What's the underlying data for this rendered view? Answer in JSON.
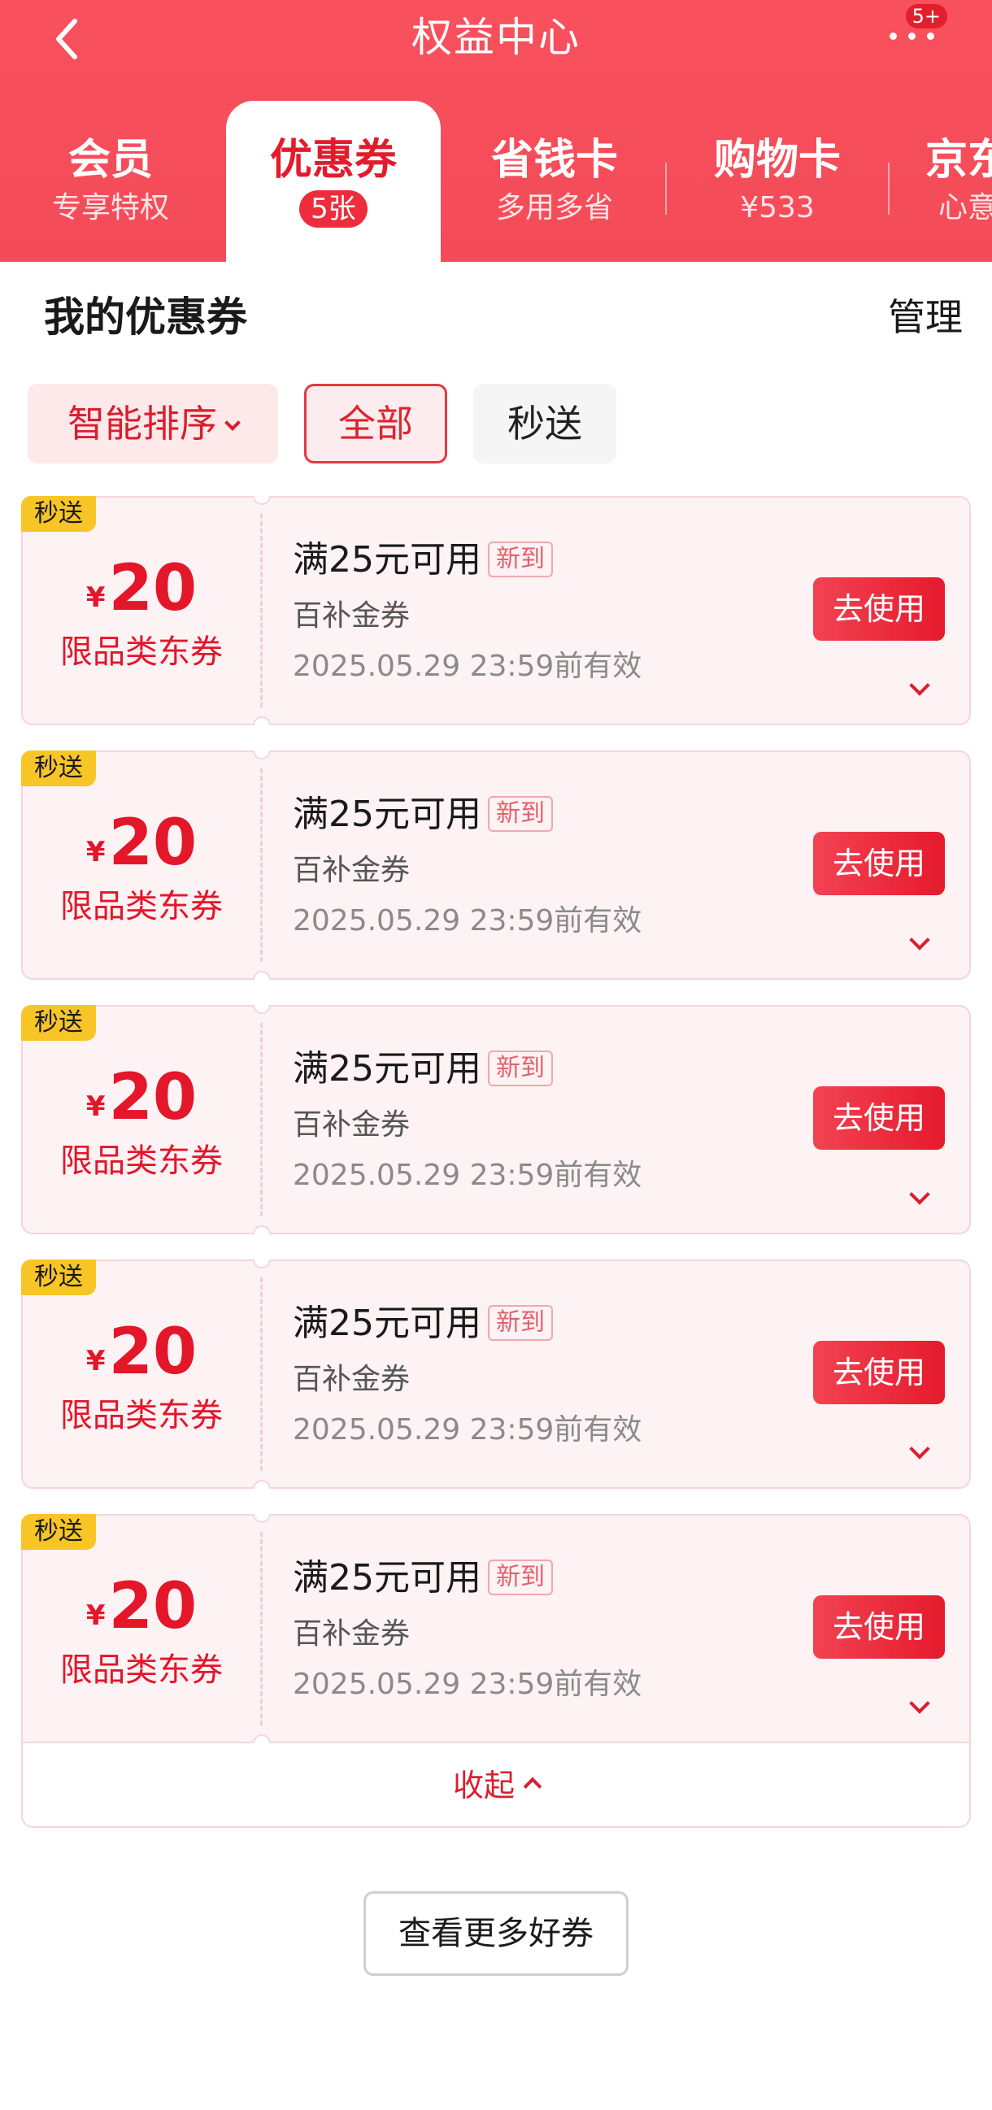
{
  "header": {
    "title": "权益中心",
    "more_badge": "5+",
    "tabs": [
      {
        "title": "会员",
        "subtitle": "专享特权"
      },
      {
        "title": "优惠券",
        "subtitle": "5张"
      },
      {
        "title": "省钱卡",
        "subtitle": "多用多省"
      },
      {
        "title": "购物卡",
        "subtitle": "¥533"
      },
      {
        "title": "京东",
        "subtitle": "心意"
      }
    ],
    "active_tab": "优惠券"
  },
  "section": {
    "title": "我的优惠券",
    "manage_label": "管理"
  },
  "filters": {
    "sort_label": "智能排序",
    "all_label": "全部",
    "fast_label": "秒送",
    "selected": "全部"
  },
  "coupons": [
    {
      "tag": "秒送",
      "currency": "¥",
      "amount": "20",
      "category": "限品类东券",
      "condition": "满25元可用",
      "new_badge": "新到",
      "type": "百补金券",
      "valid": "2025.05.29 23:59前有效",
      "button": "去使用"
    },
    {
      "tag": "秒送",
      "currency": "¥",
      "amount": "20",
      "category": "限品类东券",
      "condition": "满25元可用",
      "new_badge": "新到",
      "type": "百补金券",
      "valid": "2025.05.29 23:59前有效",
      "button": "去使用"
    },
    {
      "tag": "秒送",
      "currency": "¥",
      "amount": "20",
      "category": "限品类东券",
      "condition": "满25元可用",
      "new_badge": "新到",
      "type": "百补金券",
      "valid": "2025.05.29 23:59前有效",
      "button": "去使用"
    },
    {
      "tag": "秒送",
      "currency": "¥",
      "amount": "20",
      "category": "限品类东券",
      "condition": "满25元可用",
      "new_badge": "新到",
      "type": "百补金券",
      "valid": "2025.05.29 23:59前有效",
      "button": "去使用"
    },
    {
      "tag": "秒送",
      "currency": "¥",
      "amount": "20",
      "category": "限品类东券",
      "condition": "满25元可用",
      "new_badge": "新到",
      "type": "百补金券",
      "valid": "2025.05.29 23:59前有效",
      "button": "去使用"
    }
  ],
  "collapse_label": "收起",
  "more_coupons_label": "查看更多好券",
  "colors": {
    "brand_red": "#f34c58",
    "accent_red": "#e3162a",
    "tag_yellow": "#f7c526",
    "card_bg": "#fdf2f4"
  },
  "icons": {
    "back": "chevron-left-icon",
    "more": "more-dots-icon",
    "sort": "chevron-down-icon",
    "expand": "chevron-down-icon",
    "collapse": "chevron-up-icon"
  }
}
